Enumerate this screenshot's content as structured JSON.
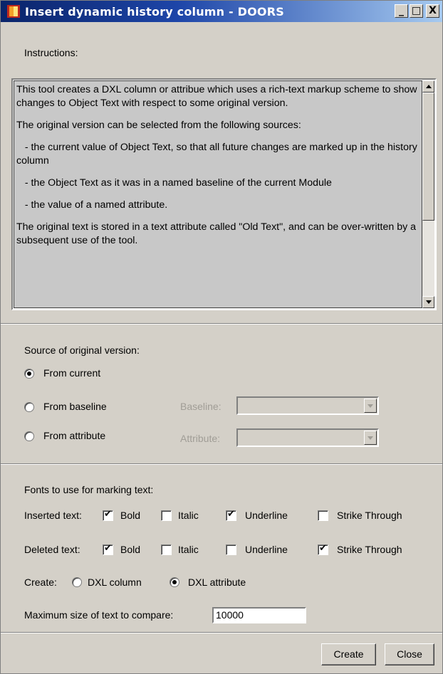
{
  "window": {
    "title": "Insert dynamic history column - DOORS",
    "buttons": [
      "_",
      "□",
      "X"
    ]
  },
  "instructions": {
    "label": "Instructions:",
    "paragraphs": [
      "This tool creates a DXL column or attribue which uses a rich-text markup scheme to show changes to Object Text with respect to some original version.",
      "The original version can be selected from the following sources:",
      "   - the current value of Object Text, so that all future changes are marked up in the history column",
      "   - the Object Text as it was in a named baseline of the current Module",
      "   - the value of a named attribute.",
      "The original text is stored in a text attribute called \"Old Text\", and can be over-written by a subsequent use of the tool."
    ]
  },
  "source": {
    "label": "Source of original version:",
    "options": [
      {
        "label": "From current",
        "checked": true
      },
      {
        "label": "From baseline",
        "checked": false
      },
      {
        "label": "From attribute",
        "checked": false
      }
    ],
    "baseline_label": "Baseline:",
    "attribute_label": "Attribute:",
    "baseline_value": "",
    "attribute_value": ""
  },
  "fonts": {
    "label": "Fonts to use for marking text:",
    "inserted_label": "Inserted text:",
    "deleted_label": "Deleted text:",
    "style_labels": [
      "Bold",
      "Italic",
      "Underline",
      "Strike Through"
    ],
    "inserted_checked": [
      true,
      false,
      true,
      false
    ],
    "deleted_checked": [
      true,
      false,
      false,
      true
    ]
  },
  "create": {
    "label": "Create:",
    "options": [
      {
        "label": "DXL column",
        "checked": false
      },
      {
        "label": "DXL attribute",
        "checked": true
      }
    ]
  },
  "max_size": {
    "label": "Maximum size of text to compare:",
    "value": "10000"
  },
  "actions": {
    "create_label": "Create",
    "close_label": "Close"
  },
  "icons": {
    "title": "doors-app-icon",
    "scroll_up": "scroll-up-arrow-icon",
    "scroll_down": "scroll-down-arrow-icon",
    "combo": "dropdown-arrow-icon"
  }
}
